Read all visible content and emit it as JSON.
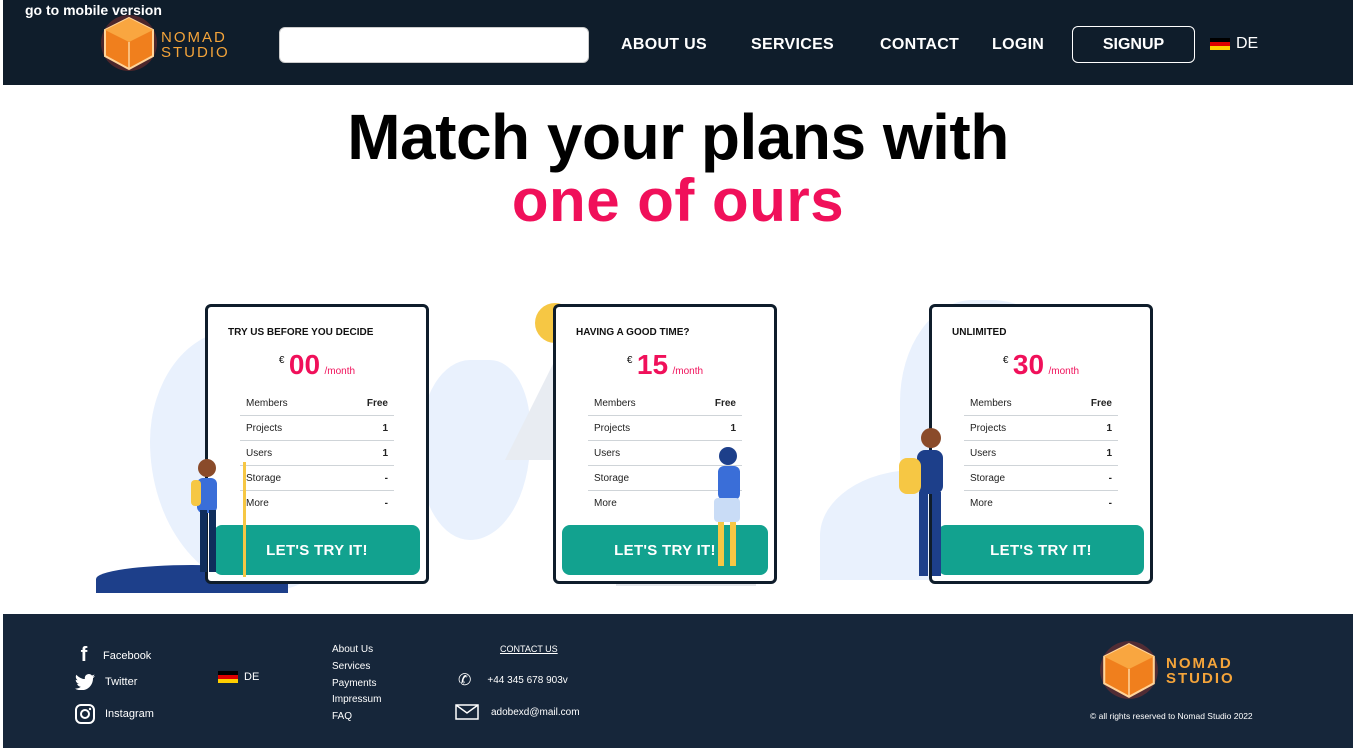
{
  "header": {
    "mobile_link": "go to mobile version",
    "logo_line1": "NOMAD",
    "logo_line2": "STUDIO",
    "nav": [
      "ABOUT US",
      "SERVICES",
      "CONTACT",
      "LOGIN"
    ],
    "signup": "SIGNUP",
    "language": "DE"
  },
  "hero": {
    "title_line1": "Match your plans with",
    "title_line2": "one of  ours"
  },
  "plans": [
    {
      "title": "TRY US BEFORE YOU DECIDE",
      "currency": "€",
      "amount": "00",
      "period": "/month",
      "rows": [
        {
          "label": "Members",
          "value": "Free"
        },
        {
          "label": "Projects",
          "value": "1"
        },
        {
          "label": "Users",
          "value": "1"
        },
        {
          "label": "Storage",
          "value": "-"
        },
        {
          "label": "More",
          "value": "-"
        }
      ],
      "cta": "LET'S TRY IT!"
    },
    {
      "title": "HAVING A GOOD TIME?",
      "currency": "€",
      "amount": "15",
      "period": "/month",
      "rows": [
        {
          "label": "Members",
          "value": "Free"
        },
        {
          "label": "Projects",
          "value": "1"
        },
        {
          "label": "Users",
          "value": ""
        },
        {
          "label": "Storage",
          "value": ""
        },
        {
          "label": "More",
          "value": ""
        }
      ],
      "cta": "LET'S TRY IT!"
    },
    {
      "title": "UNLIMITED",
      "currency": "€",
      "amount": "30",
      "period": "/month",
      "rows": [
        {
          "label": "Members",
          "value": "Free"
        },
        {
          "label": "Projects",
          "value": "1"
        },
        {
          "label": "Users",
          "value": "1"
        },
        {
          "label": "Storage",
          "value": "-"
        },
        {
          "label": "More",
          "value": "-"
        }
      ],
      "cta": "LET'S TRY IT!"
    }
  ],
  "footer": {
    "social": [
      "Facebook",
      "Twitter",
      "Instagram"
    ],
    "language": "DE",
    "links": [
      "About Us",
      "Services",
      "Payments",
      "Impressum",
      "FAQ"
    ],
    "contact_heading": "CONTACT US",
    "phone": "+44 345 678 903v",
    "email": "adobexd@mail.com",
    "copyright": "© all rights reserved to Nomad Studio 2022",
    "logo_line1": "NOMAD",
    "logo_line2": "STUDIO"
  },
  "colors": {
    "header_bg": "#0f1d2b",
    "footer_bg": "#16263a",
    "accent_pink": "#f0105a",
    "cta_teal": "#12a28f",
    "logo_orange": "#f4a43a"
  }
}
